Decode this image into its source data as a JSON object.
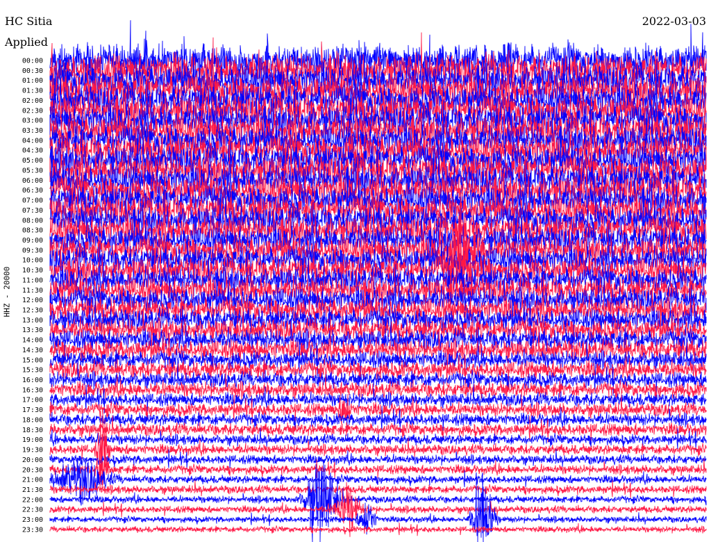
{
  "header": {
    "station": "HC Sitia",
    "status": "Applied",
    "date": "2022-03-03",
    "channel_label": "HHZ - 20000"
  },
  "colors": {
    "trace_a": "#0000ff",
    "trace_b": "#ff1744",
    "background": "#ffffff"
  },
  "chart_data": {
    "type": "line",
    "title": "HC Sitia",
    "subtitle": "2022-03-03",
    "ylabel": "HHZ - 20000",
    "xlabel": "",
    "row_labels": [
      "00:00",
      "00:30",
      "01:00",
      "01:30",
      "02:00",
      "02:30",
      "03:00",
      "03:30",
      "04:00",
      "04:30",
      "05:00",
      "05:30",
      "06:00",
      "06:30",
      "07:00",
      "07:30",
      "08:00",
      "08:30",
      "09:00",
      "09:30",
      "10:00",
      "10:30",
      "11:00",
      "11:30",
      "12:00",
      "12:30",
      "13:00",
      "13:30",
      "14:00",
      "14:30",
      "15:00",
      "15:30",
      "16:00",
      "16:30",
      "17:00",
      "17:30",
      "18:00",
      "18:30",
      "19:00",
      "19:30",
      "20:00",
      "20:30",
      "21:00",
      "21:30",
      "22:00",
      "22:30",
      "23:00",
      "23:30"
    ],
    "row_colors": [
      "blue",
      "red"
    ],
    "minutes_per_row": 30,
    "noise_amplitude_by_hour": [
      3.2,
      3.2,
      3.1,
      3.1,
      3.0,
      3.0,
      3.0,
      2.9,
      2.8,
      2.7,
      2.6,
      2.5,
      2.4,
      2.2,
      2.0,
      1.7,
      1.5,
      1.3,
      1.2,
      1.0,
      0.9,
      0.8,
      0.7,
      0.6
    ],
    "events": [
      {
        "row": "09:30",
        "minute": 18.8,
        "amplitude": 2.0,
        "duration_min": 1.5
      },
      {
        "row": "10:30",
        "minute": 18.8,
        "amplitude": 2.0,
        "duration_min": 1.5
      },
      {
        "row": "04:30",
        "minute": 14.0,
        "amplitude": 1.5,
        "duration_min": 0.6
      },
      {
        "row": "19:30",
        "minute": 2.4,
        "amplitude": 2.5,
        "duration_min": 0.4
      },
      {
        "row": "20:30",
        "minute": 2.4,
        "amplitude": 2.5,
        "duration_min": 0.4
      },
      {
        "row": "21:00",
        "minute": 1.4,
        "amplitude": 1.4,
        "duration_min": 2.0
      },
      {
        "row": "22:00",
        "minute": 12.4,
        "amplitude": 3.0,
        "duration_min": 1.2
      },
      {
        "row": "22:30",
        "minute": 13.6,
        "amplitude": 1.6,
        "duration_min": 1.0
      },
      {
        "row": "23:00",
        "minute": 14.5,
        "amplitude": 1.5,
        "duration_min": 0.6
      },
      {
        "row": "23:00",
        "minute": 19.8,
        "amplitude": 3.2,
        "duration_min": 0.8
      },
      {
        "row": "17:30",
        "minute": 13.5,
        "amplitude": 1.5,
        "duration_min": 0.4
      }
    ]
  }
}
